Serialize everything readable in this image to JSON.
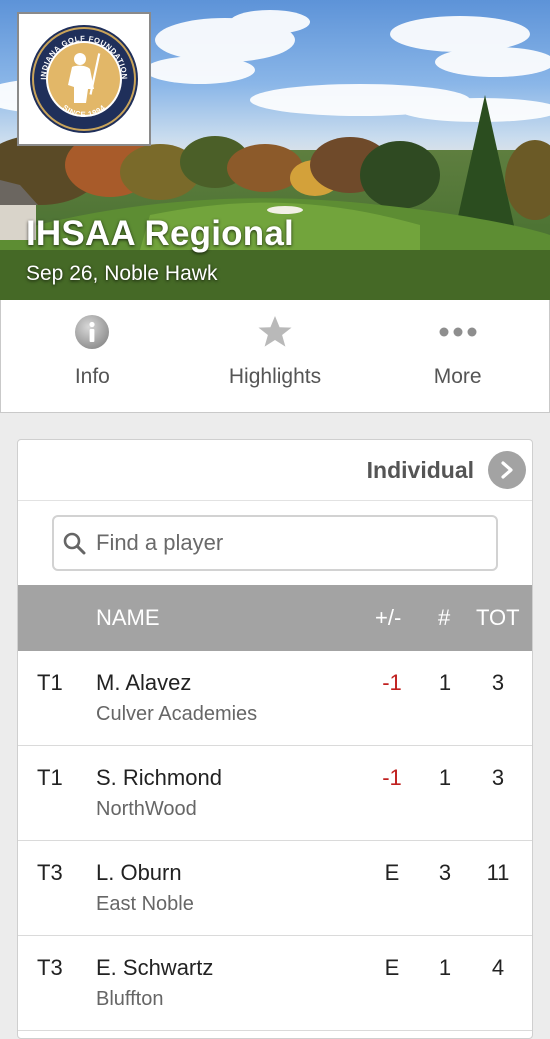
{
  "hero": {
    "logo_ring_text_top": "INDIANA GOLF FOUNDATION",
    "logo_ring_text_bottom": "SINCE 1994",
    "title": "IHSAA Regional",
    "subtitle": "Sep 26, Noble Hawk"
  },
  "tabs": [
    {
      "label": "Info",
      "icon": "info-icon"
    },
    {
      "label": "Highlights",
      "icon": "star-icon"
    },
    {
      "label": "More",
      "icon": "more-dots-icon"
    }
  ],
  "leaderboard": {
    "view_label": "Individual",
    "search_placeholder": "Find a player",
    "columns": {
      "name": "NAME",
      "par": "+/-",
      "hole": "#",
      "total": "TOT"
    },
    "colors": {
      "under_par": "#c0201f",
      "header_bg": "#a3a3a3"
    },
    "rows": [
      {
        "pos": "T1",
        "name": "M. Alavez",
        "team": "Culver Academies",
        "par": "-1",
        "hole": "1",
        "total": "3"
      },
      {
        "pos": "T1",
        "name": "S. Richmond",
        "team": "NorthWood",
        "par": "-1",
        "hole": "1",
        "total": "3"
      },
      {
        "pos": "T3",
        "name": "L. Oburn",
        "team": "East Noble",
        "par": "E",
        "hole": "3",
        "total": "11"
      },
      {
        "pos": "T3",
        "name": "E. Schwartz",
        "team": "Bluffton",
        "par": "E",
        "hole": "1",
        "total": "4"
      }
    ]
  }
}
